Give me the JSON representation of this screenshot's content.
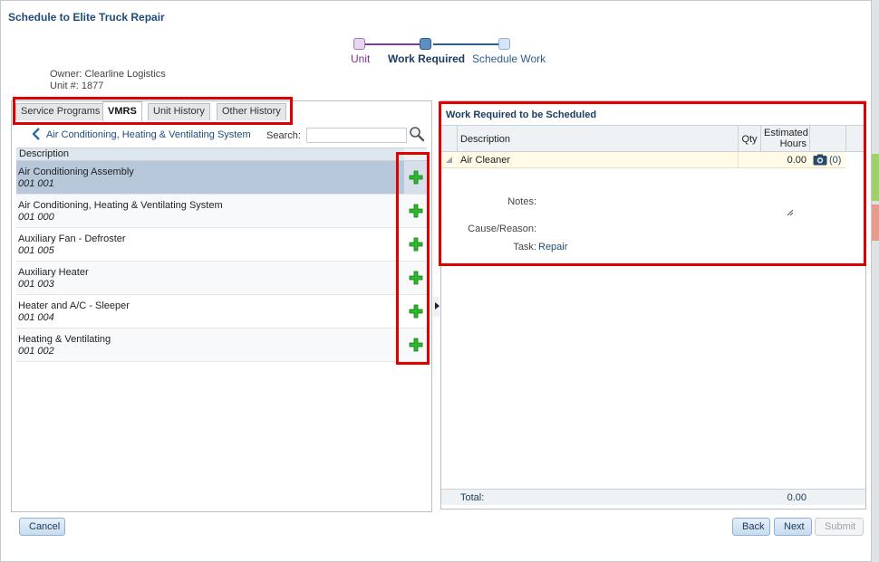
{
  "dialog": {
    "title": "Schedule to Elite Truck Repair"
  },
  "train": {
    "stops": [
      {
        "label": "Unit"
      },
      {
        "label": "Work Required"
      },
      {
        "label": "Schedule Work"
      }
    ]
  },
  "info": {
    "owner_label": "Owner:",
    "owner_value": "Clearline Logistics",
    "unit_label": "Unit #:",
    "unit_value": "1877"
  },
  "tabs": [
    {
      "label": "Service Programs"
    },
    {
      "label": "VMRS"
    },
    {
      "label": "Unit History"
    },
    {
      "label": "Other History"
    }
  ],
  "vmrs": {
    "breadcrumb": "Air Conditioning, Heating & Ventilating System",
    "search_label": "Search:",
    "search_value": "",
    "column_header": "Description",
    "items": [
      {
        "name": "Air Conditioning Assembly",
        "code": "001 001"
      },
      {
        "name": "Air Conditioning, Heating & Ventilating System",
        "code": "001 000"
      },
      {
        "name": "Auxiliary Fan - Defroster",
        "code": "001 005"
      },
      {
        "name": "Auxiliary Heater",
        "code": "001 003"
      },
      {
        "name": "Heater and A/C - Sleeper",
        "code": "001 004"
      },
      {
        "name": "Heating & Ventilating",
        "code": "001 002"
      }
    ]
  },
  "work": {
    "title": "Work Required to be Scheduled",
    "col_description": "Description",
    "col_qty": "Qty",
    "col_hours_1": "Estimated",
    "col_hours_2": "Hours",
    "row": {
      "description": "Air Cleaner",
      "qty": "",
      "hours": "0.00",
      "attachments": "(0)"
    },
    "notes_label": "Notes:",
    "cause_label": "Cause/Reason:",
    "task_label": "Task:",
    "task_value": "Repair",
    "total_label": "Total:",
    "total_value": "0.00"
  },
  "buttons": {
    "cancel": "Cancel",
    "back": "Back",
    "next": "Next",
    "submit": "Submit"
  },
  "colors": {
    "highlight": "#e00000",
    "accent": "#1d4c7a",
    "add_icon": "#2db82d"
  }
}
